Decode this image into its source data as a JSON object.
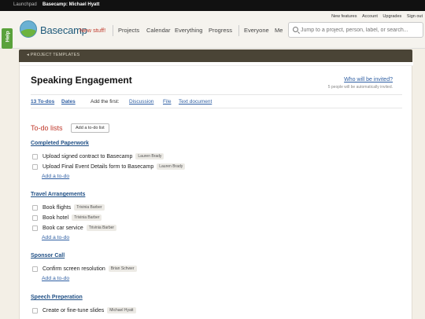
{
  "topbar": {
    "launchpad": "Launchpad",
    "account": "Basecamp: Michael Hyatt"
  },
  "header": {
    "utilities": [
      "New features",
      "Account",
      "Upgrades",
      "Sign out"
    ],
    "logo_text": "Basecamp",
    "new_stuff": "New stuff!",
    "nav": [
      "Projects",
      "Calendar",
      "Everything",
      "Progress",
      "Everyone",
      "Me"
    ],
    "search_placeholder": "Jump to a project, person, label, or search..."
  },
  "help": "Help",
  "templates_bar": "◂ PROJECT TEMPLATES",
  "project": {
    "title": "Speaking Engagement",
    "invite_link": "Who will be invited?",
    "invite_note": "5 people will be automatically invited."
  },
  "tabs": {
    "todos": "13 To-dos",
    "dates": "Dates",
    "add_first": "Add the first:",
    "discussion": "Discussion",
    "file": "File",
    "text_document": "Text document"
  },
  "todo_section": {
    "heading": "To-do lists",
    "add_list_button": "Add a to-do list"
  },
  "lists": [
    {
      "title": "Completed Paperwork",
      "items": [
        {
          "text": "Upload signed contract to Basecamp",
          "assignee": "Lauren Brady"
        },
        {
          "text": "Upload Final Event Details form to Basecamp",
          "assignee": "Lauren Brady"
        }
      ],
      "add": "Add a to-do"
    },
    {
      "title": "Travel Arrangements",
      "items": [
        {
          "text": "Book flights",
          "assignee": "Trivinia Barber"
        },
        {
          "text": "Book hotel",
          "assignee": "Trivinia Barber"
        },
        {
          "text": "Book car service",
          "assignee": "Trivinia Barber"
        }
      ],
      "add": "Add a to-do"
    },
    {
      "title": "Sponsor Call",
      "items": [
        {
          "text": "Confirm screen resolution",
          "assignee": "Brian Schwer"
        }
      ],
      "add": "Add a to-do"
    },
    {
      "title": "Speech Preperation",
      "items": [
        {
          "text": "Create or fine-tune slides",
          "assignee": "Michael Hyatt"
        }
      ]
    }
  ]
}
